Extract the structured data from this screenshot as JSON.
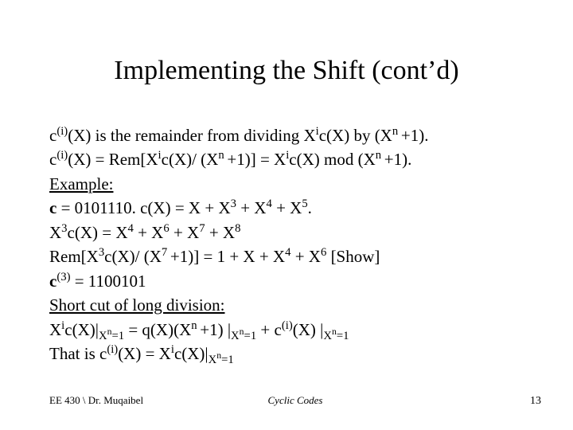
{
  "title": "Implementing the Shift (cont’d)",
  "lines": {
    "l1a": "c",
    "l1b": "(i)",
    "l1c": "(X) is the remainder from dividing X",
    "l1d": "i",
    "l1e": "c(X) by (X",
    "l1f": "n ",
    "l1g": "+1).",
    "l2a": "c",
    "l2b": "(i)",
    "l2c": "(X) = Rem[X",
    "l2d": "i",
    "l2e": "c(X)/ (X",
    "l2f": "n ",
    "l2g": "+1)] = X",
    "l2h": "i",
    "l2i": "c(X) mod (X",
    "l2j": "n ",
    "l2k": "+1).",
    "l3": "Example:",
    "l4a": "c",
    "l4b": " = 0101110. c(X) = X + X",
    "l4c": "3",
    "l4d": " + X",
    "l4e": "4",
    "l4f": " + X",
    "l4g": "5",
    "l4h": ".",
    "l5a": "X",
    "l5b": "3",
    "l5c": "c(X) = X",
    "l5d": "4",
    "l5e": " + X",
    "l5f": "6",
    "l5g": " + X",
    "l5h": "7",
    "l5i": " + X",
    "l5j": "8",
    "l6a": "Rem[X",
    "l6b": "3",
    "l6c": "c(X)/ (X",
    "l6d": "7 ",
    "l6e": "+1)] = 1 + X + X",
    "l6f": "4",
    "l6g": " + X",
    "l6h": "6",
    "l6i": " [Show]",
    "l7a": "c",
    "l7b": "(3)",
    "l7c": " = 1100101",
    "l8": "Short cut of long division:",
    "l9a": " X",
    "l9b": "i",
    "l9c": "c(X)|",
    "l9d": "X",
    "l9e": "n",
    "l9f": "=1",
    "l9g": " = q(X)(X",
    "l9h": "n ",
    "l9i": "+1) |",
    "l9j": "X",
    "l9k": "n",
    "l9l": "=1",
    "l9m": " + c",
    "l9n": "(i)",
    "l9o": "(X) |",
    "l9p": "X",
    "l9q": "n",
    "l9r": "=1",
    "l10a": "That is c",
    "l10b": "(i)",
    "l10c": "(X) = X",
    "l10d": "i",
    "l10e": "c(X)|",
    "l10f": "X",
    "l10g": "n",
    "l10h": "=1",
    "fl": "EE 430 \\ Dr. Muqaibel",
    "fc": "Cyclic Codes",
    "fr": "13"
  }
}
